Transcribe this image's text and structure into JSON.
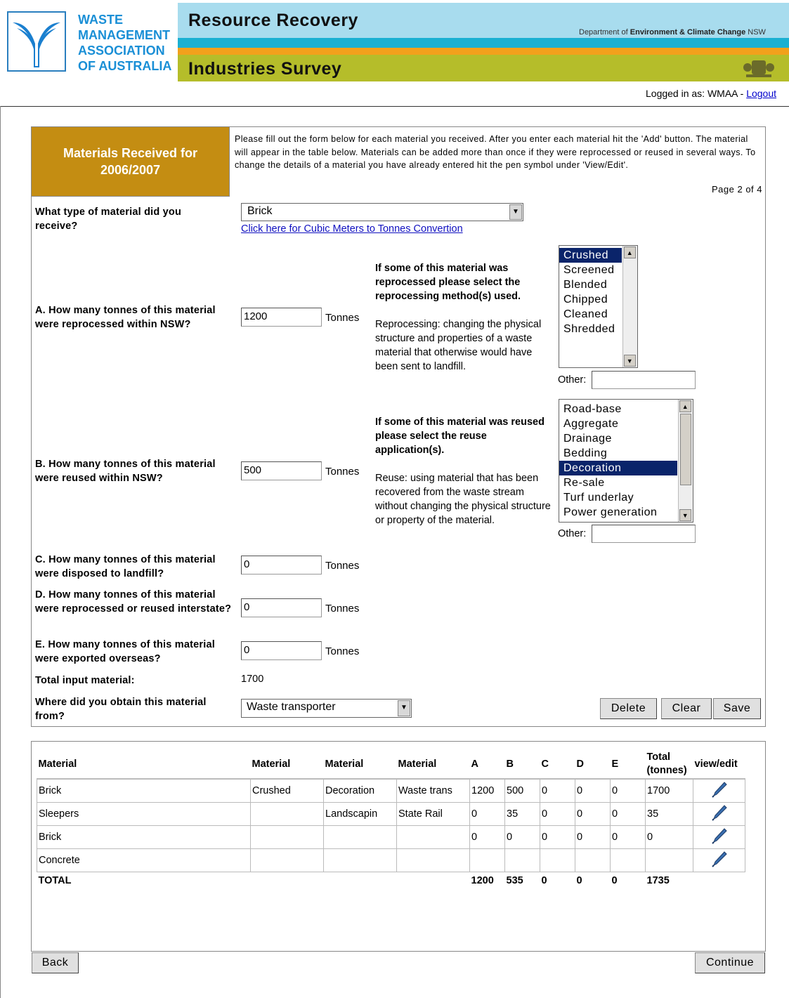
{
  "header": {
    "org_line1": "WASTE",
    "org_line2": "MANAGEMENT",
    "org_line3": "ASSOCIATION",
    "org_line4": "OF AUSTRALIA",
    "title_top": "Resource Recovery",
    "title_bottom": "Industries Survey",
    "dept_prefix": "Department of ",
    "dept_name": "Environment & Climate Change",
    "dept_suffix": " NSW",
    "logged_prefix": "Logged in as: WMAA - ",
    "logout": "Logout"
  },
  "section": {
    "title": "Materials Received for 2006/2007",
    "instructions": "Please fill out the form below for each material you received. After you enter each material hit the 'Add' button. The material will appear in the table below. Materials can be added more than once if they were reprocessed or reused in several ways. To change the details of a material you have already entered hit the pen symbol under 'View/Edit'.",
    "page": "Page 2 of 4"
  },
  "form": {
    "material_q": "What type of material did you receive?",
    "material_value": "Brick",
    "conversion_link": "Click here for Cubic Meters to Tonnes Convertion",
    "a_q": "A. How many tonnes of this material were reprocessed within NSW?",
    "a_value": "1200",
    "b_q": "B. How many tonnes of this material were reused within NSW?",
    "b_value": "500",
    "c_q": "C. How many tonnes of this material were disposed to landfill?",
    "c_value": "0",
    "d_q": "D. How many tonnes of this material were reprocessed or reused interstate?",
    "d_value": "0",
    "e_q": "E. How many tonnes of this material were exported overseas?",
    "e_value": "0",
    "unit": "Tonnes",
    "total_label": "Total input material:",
    "total_value": "1700",
    "source_q": "Where did you obtain this material from?",
    "source_value": "Waste transporter",
    "reprocess_heading": "If some of this material was reprocessed please select the reprocessing method(s) used.",
    "reprocess_help": "Reprocessing: changing the physical structure and properties of a waste material that otherwise would have been sent to landfill.",
    "reprocess_options": [
      "Crushed",
      "Screened",
      "Blended",
      "Chipped",
      "Cleaned",
      "Shredded"
    ],
    "reprocess_selected": "Crushed",
    "reuse_heading": "If some of this material was reused please select the reuse application(s).",
    "reuse_help": "Reuse: using material that has been recovered from the waste stream without changing the physical structure or property of the material.",
    "reuse_options": [
      "Road-base",
      "Aggregate",
      "Drainage",
      "Bedding",
      "Decoration",
      "Re-sale",
      "Turf underlay",
      "Power generation"
    ],
    "reuse_selected": "Decoration",
    "other_label": "Other:",
    "delete": "Delete",
    "clear": "Clear",
    "save": "Save"
  },
  "table": {
    "headers": [
      "Material",
      "Material",
      "Material",
      "Material",
      "A",
      "B",
      "C",
      "D",
      "E",
      "Total (tonnes)",
      "view/edit"
    ],
    "rows": [
      [
        "Brick",
        "Crushed",
        "Decoration",
        "Waste trans",
        "1200",
        "500",
        "0",
        "0",
        "0",
        "1700"
      ],
      [
        "Sleepers",
        "",
        "Landscapin",
        "State Rail",
        "0",
        "35",
        "0",
        "0",
        "0",
        "35"
      ],
      [
        "Brick",
        "",
        "",
        "",
        "0",
        "0",
        "0",
        "0",
        "0",
        "0"
      ],
      [
        "Concrete",
        "",
        "",
        "",
        "",
        "",
        "",
        "",
        "",
        ""
      ]
    ],
    "total_label": "TOTAL",
    "totals": [
      "1200",
      "535",
      "0",
      "0",
      "0",
      "1735"
    ]
  },
  "nav": {
    "back": "Back",
    "continue": "Continue"
  }
}
